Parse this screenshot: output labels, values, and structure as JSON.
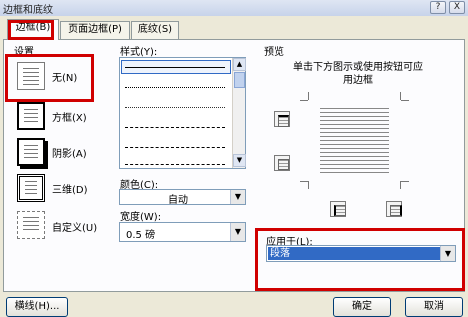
{
  "window": {
    "title": "边框和底纹"
  },
  "tabs": [
    {
      "label": "边框(B)"
    },
    {
      "label": "页面边框(P)"
    },
    {
      "label": "底纹(S)"
    }
  ],
  "settings": {
    "header": "设置",
    "options": [
      {
        "label": "无(N)"
      },
      {
        "label": "方框(X)"
      },
      {
        "label": "阴影(A)"
      },
      {
        "label": "三维(D)"
      },
      {
        "label": "自定义(U)"
      }
    ]
  },
  "style": {
    "label": "样式(Y):"
  },
  "color": {
    "label": "颜色(C):",
    "value": "自动"
  },
  "width": {
    "label": "宽度(W):",
    "value": "0.5 磅"
  },
  "preview": {
    "header": "预览",
    "instruction": "单击下方图示或使用按钮可应用边框"
  },
  "apply_to": {
    "label": "应用于(L):",
    "value": "段落"
  },
  "buttons": {
    "horizontal_line": "横线(H)...",
    "ok": "确定",
    "cancel": "取消"
  },
  "titlebar_buttons": {
    "help": "?",
    "close": "X"
  },
  "colors": {
    "highlight": "#d00000",
    "selection": "#316ac5"
  }
}
